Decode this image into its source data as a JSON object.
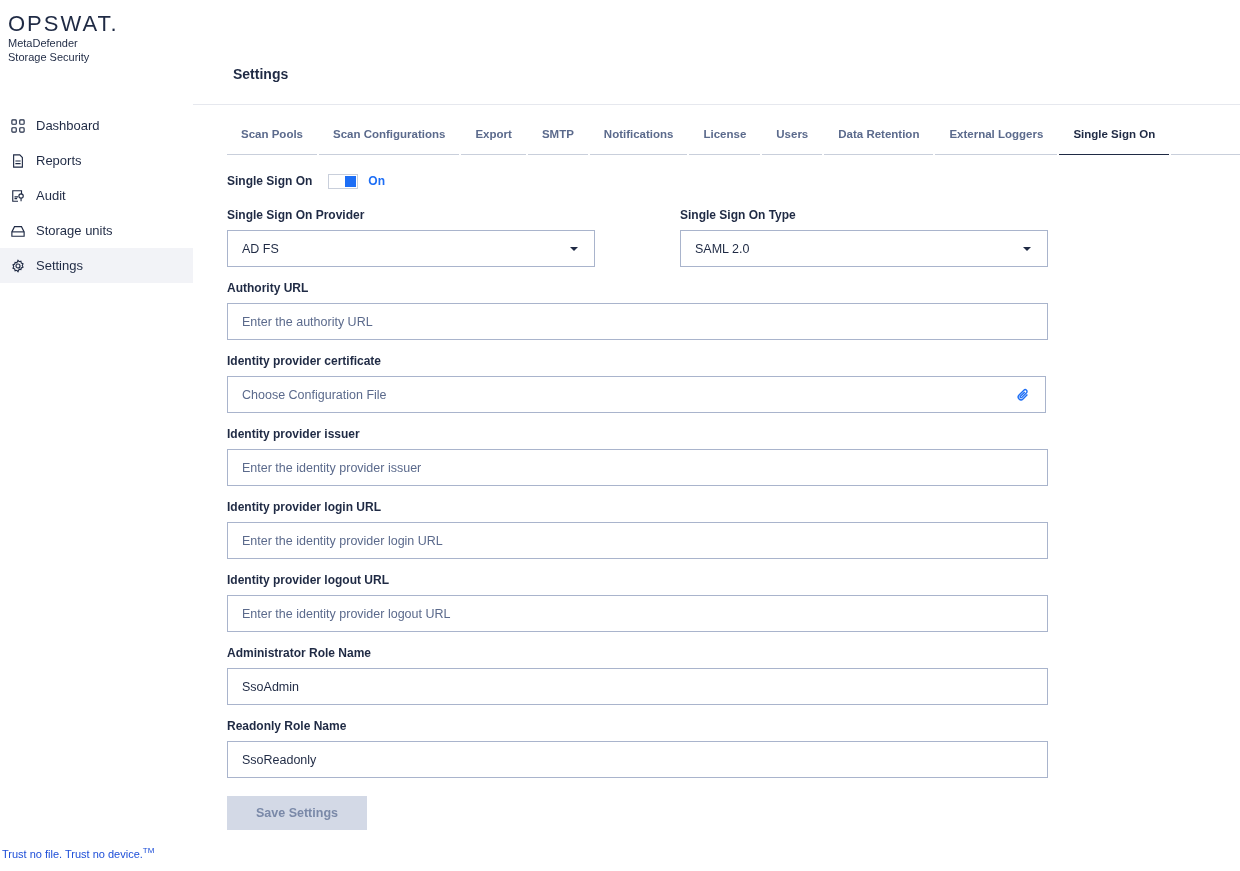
{
  "brand": {
    "logo": "OPSWAT.",
    "product": "MetaDefender",
    "subtitle": "Storage Security"
  },
  "sidebar": {
    "items": [
      {
        "label": "Dashboard",
        "selected": false
      },
      {
        "label": "Reports",
        "selected": false
      },
      {
        "label": "Audit",
        "selected": false
      },
      {
        "label": "Storage units",
        "selected": false
      },
      {
        "label": "Settings",
        "selected": true
      }
    ]
  },
  "tagline": "Trust no file. Trust no device.$^{TM}$",
  "page_title": "Settings",
  "tabs": [
    {
      "label": "Scan Pools",
      "selected": false
    },
    {
      "label": "Scan Configurations",
      "selected": false
    },
    {
      "label": "Export",
      "selected": false
    },
    {
      "label": "SMTP",
      "selected": false
    },
    {
      "label": "Notifications",
      "selected": false
    },
    {
      "label": "License",
      "selected": false
    },
    {
      "label": "Users",
      "selected": false
    },
    {
      "label": "Data Retention",
      "selected": false
    },
    {
      "label": "External Loggers",
      "selected": false
    },
    {
      "label": "Single Sign On",
      "selected": true
    }
  ],
  "form": {
    "toggle": {
      "label": "Single Sign On",
      "on": true,
      "state_text": "On"
    },
    "selects": [
      {
        "label": "Single Sign On Provider",
        "value": "AD FS"
      },
      {
        "label": "Single Sign On Type",
        "value": "SAML 2.0"
      }
    ],
    "fields": [
      {
        "kind": "text",
        "label": "Authority URL",
        "placeholder": "Enter the authority URL"
      },
      {
        "kind": "file",
        "label": "Identity provider certificate",
        "placeholder": "Choose Configuration File"
      },
      {
        "kind": "text",
        "label": "Identity provider issuer",
        "placeholder": "Enter the identity provider issuer"
      },
      {
        "kind": "text",
        "label": "Identity provider login URL",
        "placeholder": "Enter the identity provider login URL"
      },
      {
        "kind": "text",
        "label": "Identity provider logout URL",
        "placeholder": "Enter the identity provider logout URL"
      },
      {
        "kind": "text",
        "label": "Administrator Role Name",
        "value": "SsoAdmin"
      },
      {
        "kind": "text",
        "label": "Readonly Role Name",
        "value": "SsoReadonly"
      }
    ]
  },
  "save_button": {
    "label": "Save Settings",
    "disabled": true
  }
}
